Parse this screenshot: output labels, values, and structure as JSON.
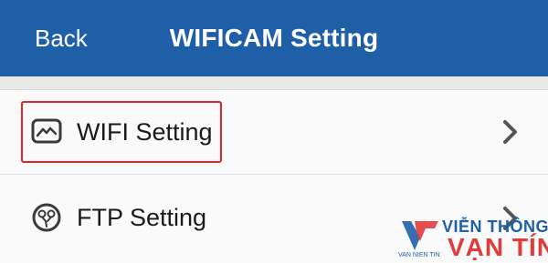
{
  "header": {
    "back_label": "Back",
    "title": "WIFICAM  Setting"
  },
  "rows": [
    {
      "label": "WIFI Setting",
      "icon": "wifi-setting-icon"
    },
    {
      "label": "FTP Setting",
      "icon": "ftp-setting-icon"
    }
  ],
  "watermark": {
    "line1": "VIỄN THÔNG",
    "line2": "VẠN TÍN",
    "small": "VAN NIEN TIN"
  },
  "colors": {
    "header": "#1f5fa8",
    "highlight": "#e0262b",
    "background": "#ebebeb"
  }
}
